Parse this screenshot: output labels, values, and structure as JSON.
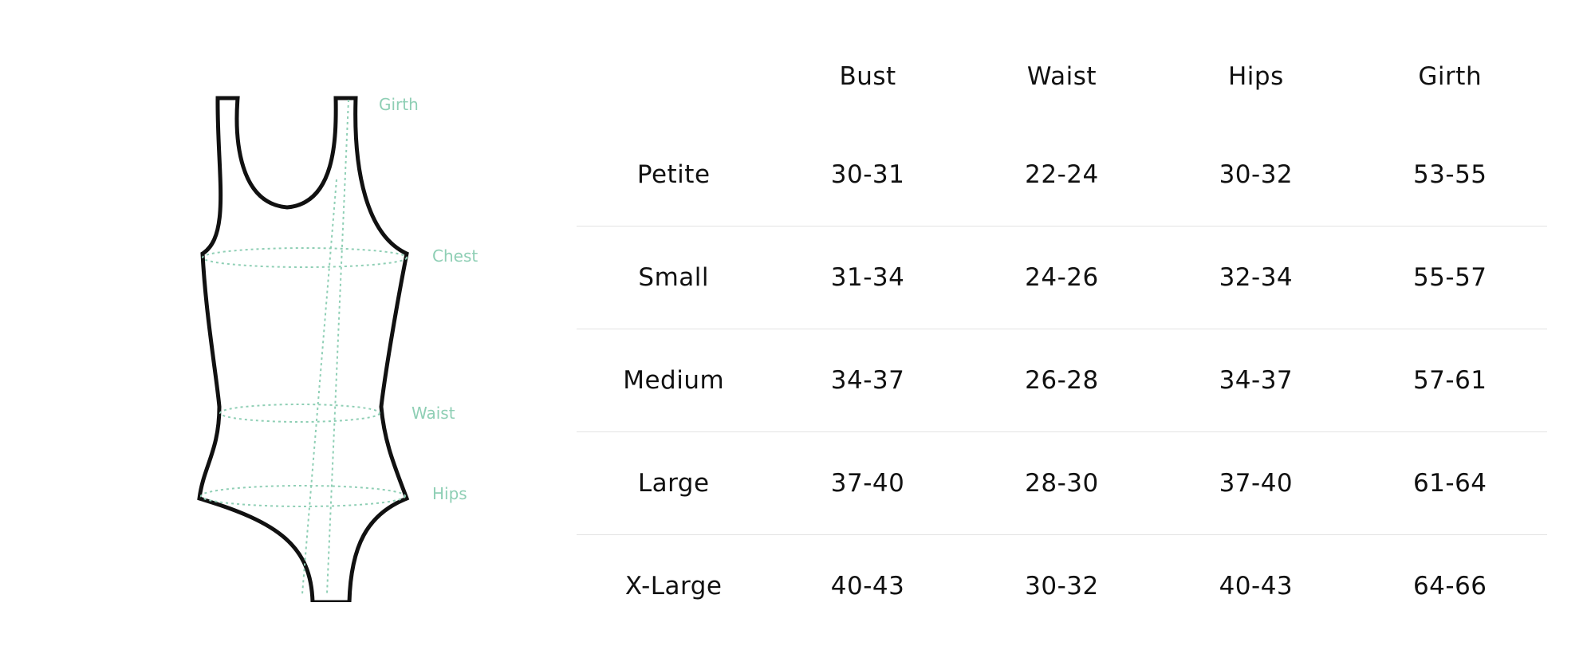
{
  "figure": {
    "labels": {
      "girth": "Girth",
      "chest": "Chest",
      "waist": "Waist",
      "hips": "Hips"
    },
    "colors": {
      "outline": "#111111",
      "measure": "#8fcfb5"
    },
    "icon": "swimsuit-outline-icon"
  },
  "table": {
    "columns": [
      "",
      "Bust",
      "Waist",
      "Hips",
      "Girth"
    ],
    "rows": [
      [
        "Petite",
        "30-31",
        "22-24",
        "30-32",
        "53-55"
      ],
      [
        "Small",
        "31-34",
        "24-26",
        "32-34",
        "55-57"
      ],
      [
        "Medium",
        "34-37",
        "26-28",
        "34-37",
        "57-61"
      ],
      [
        "Large",
        "37-40",
        "28-30",
        "37-40",
        "61-64"
      ],
      [
        "X-Large",
        "40-43",
        "30-32",
        "40-43",
        "64-66"
      ]
    ]
  }
}
